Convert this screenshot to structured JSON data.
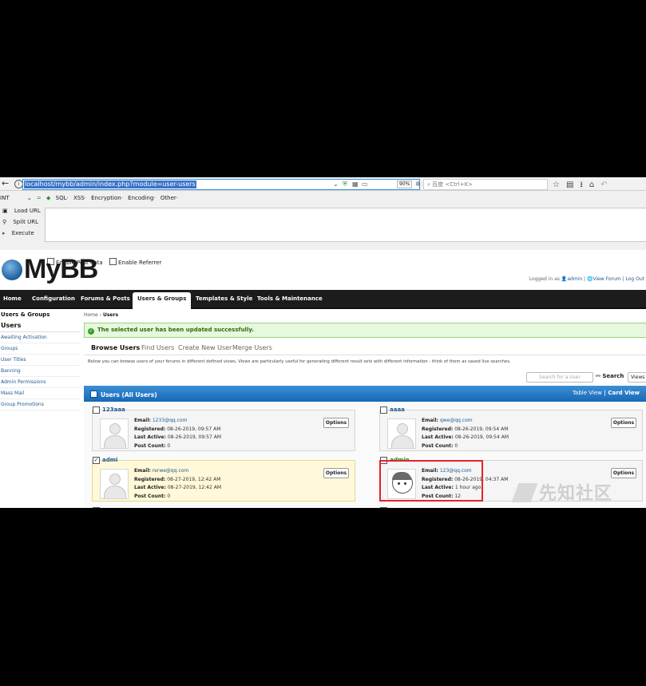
{
  "browser": {
    "url": "localhost/mybb/admin/index.php?module=user-users",
    "zoom": "90%",
    "search_placeholder": "百度 <Ctrl+K>"
  },
  "hackbar": {
    "select_value": "INT",
    "menu": [
      "SQL·",
      "XSS·",
      "Encryption·",
      "Encoding·",
      "Other·"
    ],
    "load_url": "Load URL",
    "split_url": "Split URL",
    "execute": "Execute",
    "enable_post": "Enable Post data",
    "enable_referrer": "Enable Referrer"
  },
  "header": {
    "logo": "MyBB",
    "logged_in_as": "Logged in as",
    "user": "admin",
    "view_forum": "View Forum",
    "log_out": "Log Out"
  },
  "nav": {
    "tabs": [
      "Home",
      "Configuration",
      "Forums & Posts",
      "Users & Groups",
      "Templates & Style",
      "Tools & Maintenance"
    ]
  },
  "sidebar": {
    "heading": "Users & Groups",
    "current": "Users",
    "items": [
      "Awaiting Activation",
      "Groups",
      "User Titles",
      "Banning",
      "Admin Permissions",
      "Mass Mail",
      "Group Promotions"
    ]
  },
  "breadcrumb": {
    "home": "Home",
    "sep": "›",
    "current": "Users"
  },
  "message": "The selected user has been updated successfully.",
  "subtabs": [
    "Browse Users",
    "Find Users",
    "Create New User",
    "Merge Users"
  ],
  "description": "Below you can browse users of your forums in different defined views. Views are particularly useful for generating different result sets with different information - think of them as saved live searches.",
  "search": {
    "placeholder": "Search for a User",
    "button": "Search",
    "views": "Views"
  },
  "table": {
    "title": "Users (All Users)",
    "table_view": "Table View",
    "separator": "|",
    "card_view": "Card View"
  },
  "labels": {
    "email": "Email:",
    "registered": "Registered:",
    "last_active": "Last Active:",
    "post_count": "Post Count:",
    "options": "Options"
  },
  "users": [
    {
      "name": "123aaa",
      "email": "1233@qq.com",
      "registered": "08-26-2019, 09:57 AM",
      "last_active": "08-26-2019, 09:57 AM",
      "post_count": "0"
    },
    {
      "name": "aaaa",
      "email": "qwe@qq.com",
      "registered": "08-26-2019, 09:54 AM",
      "last_active": "08-26-2019, 09:54 AM",
      "post_count": "0"
    },
    {
      "name": "admi",
      "email": "rerwe@qq.com",
      "registered": "08-27-2019, 12:42 AM",
      "last_active": "08-27-2019, 12:42 AM",
      "post_count": "0"
    },
    {
      "name": "admin",
      "email": "123@qq.com",
      "registered": "08-26-2019, 04:37 AM",
      "last_active": "1 hour ago",
      "post_count": "12"
    }
  ],
  "watermark": "先知社区"
}
